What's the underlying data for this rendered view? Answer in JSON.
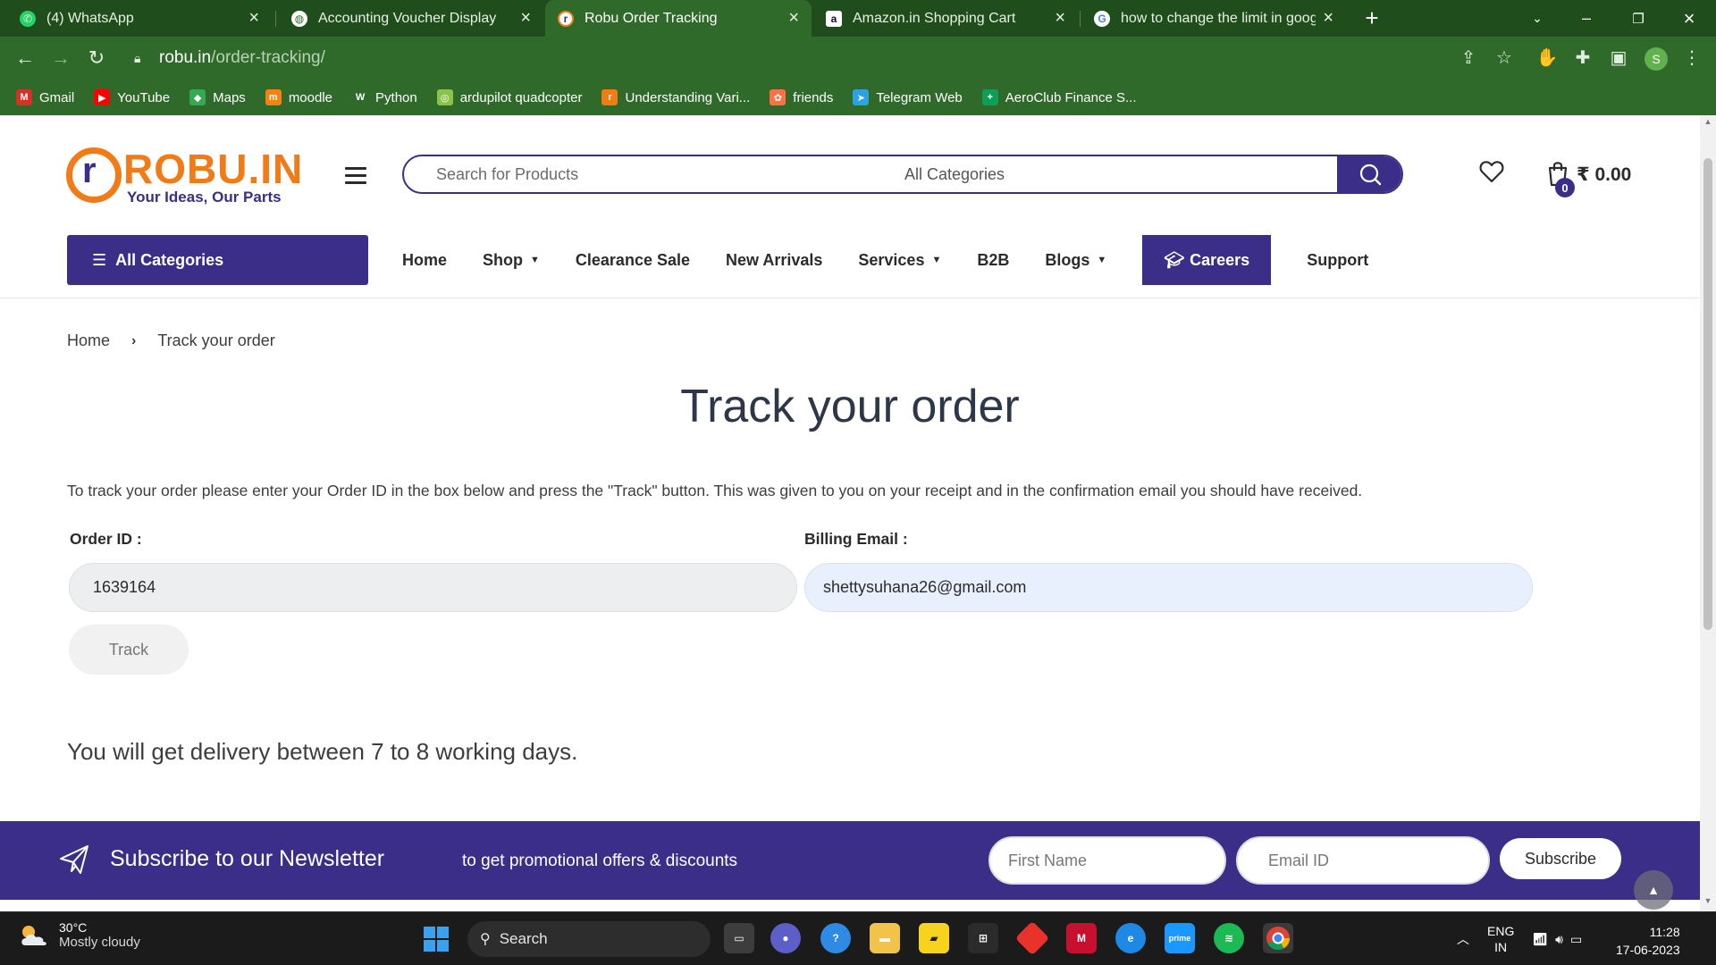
{
  "browser": {
    "tabs": [
      {
        "title": "(4) WhatsApp",
        "icon": "whatsapp-icon",
        "active": false
      },
      {
        "title": "Accounting Voucher Display",
        "icon": "globe-icon",
        "active": false
      },
      {
        "title": "Robu Order Tracking",
        "icon": "robu-icon",
        "active": true
      },
      {
        "title": "Amazon.in Shopping Cart",
        "icon": "amazon-icon",
        "active": false
      },
      {
        "title": "how to change the limit in googl",
        "icon": "google-icon",
        "active": false
      }
    ],
    "url_host": "robu.in",
    "url_path": "/order-tracking/",
    "profile_initial": "S",
    "bookmarks": [
      {
        "label": "Gmail",
        "icon": "gmail-icon",
        "color": "#d93025",
        "glyph": "M"
      },
      {
        "label": "YouTube",
        "icon": "youtube-icon",
        "color": "#ff0000",
        "glyph": "▶"
      },
      {
        "label": "Maps",
        "icon": "maps-icon",
        "color": "#34a853",
        "glyph": "◆"
      },
      {
        "label": "moodle",
        "icon": "moodle-icon",
        "color": "#f98012",
        "glyph": "m"
      },
      {
        "label": "Python",
        "icon": "python-icon",
        "color": "#2f6a2a",
        "glyph": "W"
      },
      {
        "label": "ardupilot quadcopter",
        "icon": "ardupilot-icon",
        "color": "#8bc34a",
        "glyph": "◎"
      },
      {
        "label": "Understanding Vari...",
        "icon": "robu-icon",
        "color": "#f07b17",
        "glyph": "r"
      },
      {
        "label": "friends",
        "icon": "friends-icon",
        "color": "#ff7043",
        "glyph": "✿"
      },
      {
        "label": "Telegram Web",
        "icon": "telegram-icon",
        "color": "#2aa3df",
        "glyph": "➤"
      },
      {
        "label": "AeroClub Finance S...",
        "icon": "sheets-icon",
        "color": "#0f9d58",
        "glyph": "+"
      }
    ]
  },
  "site": {
    "logo_text": "ROBU.IN",
    "logo_letter": "r",
    "tagline": "Your Ideas, Our Parts",
    "search_placeholder": "Search for Products",
    "category_select": "All Categories",
    "cart_count": "0",
    "cart_total": "₹ 0.00",
    "all_categories_label": "All Categories",
    "nav": [
      {
        "label": "Home",
        "dropdown": false
      },
      {
        "label": "Shop",
        "dropdown": true
      },
      {
        "label": "Clearance Sale",
        "dropdown": false
      },
      {
        "label": "New Arrivals",
        "dropdown": false
      },
      {
        "label": "Services",
        "dropdown": true
      },
      {
        "label": "B2B",
        "dropdown": false
      },
      {
        "label": "Blogs",
        "dropdown": true
      }
    ],
    "careers_label": "Careers",
    "support_label": "Support",
    "accent_color": "#3a2e88",
    "logo_color": "#f07b17"
  },
  "page": {
    "breadcrumb": {
      "home": "Home",
      "current": "Track your order"
    },
    "title": "Track your order",
    "instructions": "To track your order please enter your Order ID in the box below and press the \"Track\" button. This was given to you on your receipt and in the confirmation email you should have received.",
    "order_id_label": "Order ID :",
    "order_id_value": "1639164",
    "email_label": "Billing Email :",
    "email_value": "shettysuhana26@gmail.com",
    "track_button": "Track",
    "delivery_note": "You will get delivery between 7 to 8 working days."
  },
  "newsletter": {
    "title": "Subscribe to our Newsletter",
    "subtitle": "to get promotional offers & discounts",
    "first_name_placeholder": "First Name",
    "email_placeholder": "Email ID",
    "subscribe_label": "Subscribe"
  },
  "taskbar": {
    "temperature": "30°C",
    "weather": "Mostly cloudy",
    "search_label": "Search",
    "language": "ENG",
    "region": "IN",
    "time": "11:28",
    "date": "17-06-2023"
  }
}
